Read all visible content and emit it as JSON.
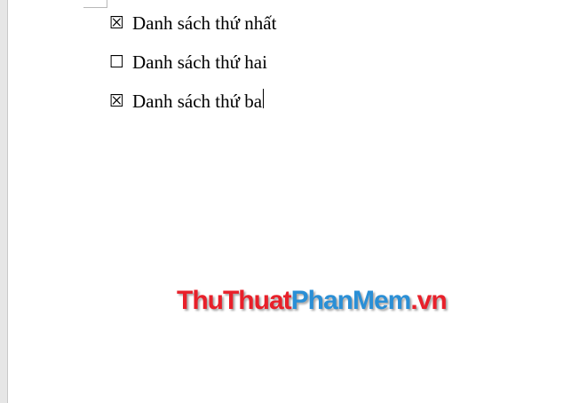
{
  "checklist": {
    "items": [
      {
        "box": "☒",
        "checked": true,
        "label": "Danh sách thứ nhất"
      },
      {
        "box": "☐",
        "checked": false,
        "label": "Danh sách thứ hai"
      },
      {
        "box": "☒",
        "checked": true,
        "label": "Danh sách thứ ba"
      }
    ]
  },
  "watermark": {
    "part1": "ThuThuat",
    "part2": "PhanMem",
    "part3": ".vn",
    "colors": {
      "red": "#e8202a",
      "blue": "#2a8fd6"
    }
  }
}
